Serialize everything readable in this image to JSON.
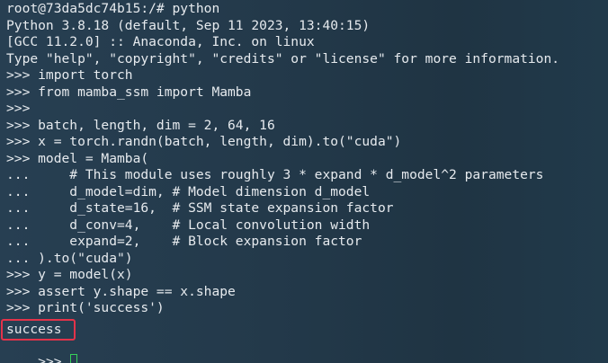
{
  "terminal": {
    "lines": [
      "root@73da5dc74b15:/# python",
      "Python 3.8.18 (default, Sep 11 2023, 13:40:15)",
      "[GCC 11.2.0] :: Anaconda, Inc. on linux",
      "Type \"help\", \"copyright\", \"credits\" or \"license\" for more information.",
      ">>> import torch",
      ">>> from mamba_ssm import Mamba",
      ">>>",
      ">>> batch, length, dim = 2, 64, 16",
      ">>> x = torch.randn(batch, length, dim).to(\"cuda\")",
      ">>> model = Mamba(",
      "...     # This module uses roughly 3 * expand * d_model^2 parameters",
      "...     d_model=dim, # Model dimension d_model",
      "...     d_state=16,  # SSM state expansion factor",
      "...     d_conv=4,    # Local convolution width",
      "...     expand=2,    # Block expansion factor",
      "... ).to(\"cuda\")",
      ">>> y = model(x)",
      ">>> assert y.shape == x.shape",
      ">>> print('success')",
      "success"
    ],
    "prompt": ">>> ",
    "highlight_color": "#e3334a",
    "cursor_color": "#37d05a"
  }
}
